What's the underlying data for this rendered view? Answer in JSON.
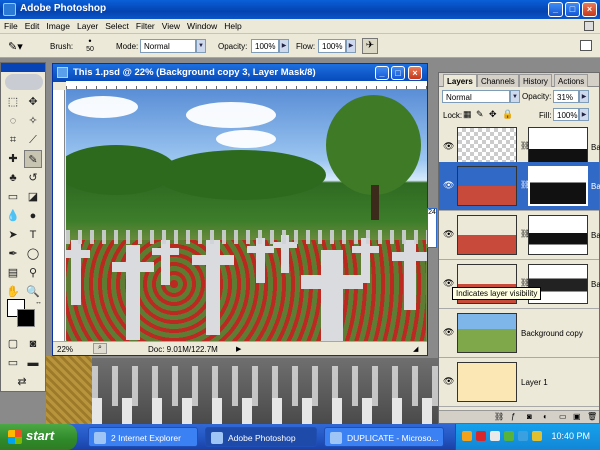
{
  "app": {
    "title": "Adobe Photoshop"
  },
  "menu": [
    "File",
    "Edit",
    "Image",
    "Layer",
    "Select",
    "Filter",
    "View",
    "Window",
    "Help"
  ],
  "options": {
    "brush_label": "Brush:",
    "brush_size": "50",
    "mode_label": "Mode:",
    "mode_value": "Normal",
    "opacity_label": "Opacity:",
    "opacity_value": "100%",
    "flow_label": "Flow:",
    "flow_value": "100%"
  },
  "document": {
    "title": "This 1.psd @ 22% (Background copy 3, Layer Mask/8)",
    "zoom": "22%",
    "doc_info": "Doc: 9.01M/122.7M"
  },
  "layers_panel": {
    "tabs": [
      "Layers",
      "Channels",
      "History",
      "Actions"
    ],
    "blend_mode": "Normal",
    "opacity_label": "Opacity:",
    "opacity_value": "31%",
    "lock_label": "Lock:",
    "fill_label": "Fill:",
    "fill_value": "100%",
    "layers": [
      {
        "name": "Ba"
      },
      {
        "name": "Ba"
      },
      {
        "name": "Ba"
      },
      {
        "name": "Ba"
      },
      {
        "name": "Background copy"
      },
      {
        "name": "Layer 1"
      }
    ],
    "tooltip": "Indicates layer visibility",
    "scroll_marker": "24"
  },
  "taskbar": {
    "start_label": "start",
    "tasks": [
      {
        "label": "2 Internet Explorer"
      },
      {
        "label": "Adobe Photoshop"
      },
      {
        "label": "DUPLICATE - Microso..."
      }
    ],
    "clock": "10:40 PM"
  }
}
